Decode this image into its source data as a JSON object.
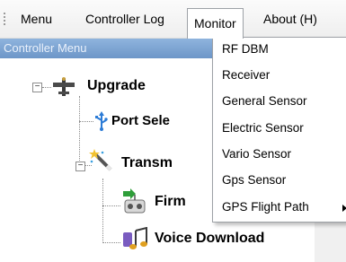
{
  "menubar": {
    "items": [
      {
        "label": "Menu"
      },
      {
        "label": "Controller Log"
      },
      {
        "label": "Monitor"
      },
      {
        "label": "About (H)"
      }
    ]
  },
  "panel": {
    "header": "Controller Menu",
    "tree": [
      {
        "label": "Upgrade",
        "icon": "airplane-icon"
      },
      {
        "label": "Port Sele",
        "icon": "usb-icon"
      },
      {
        "label": "Transm",
        "icon": "magic-wand-icon"
      },
      {
        "label": "Firm",
        "icon": "transmitter-icon"
      },
      {
        "label": "Voice Download",
        "icon": "music-note-icon"
      }
    ]
  },
  "monitor_menu": {
    "items": [
      {
        "label": "RF DBM"
      },
      {
        "label": "Receiver"
      },
      {
        "label": "General Sensor"
      },
      {
        "label": "Electric Sensor"
      },
      {
        "label": "Vario Sensor"
      },
      {
        "label": "Gps Sensor"
      },
      {
        "label": "GPS Flight Path",
        "has_submenu": true
      }
    ]
  },
  "colors": {
    "header_gradient_top": "#8fb4de",
    "header_gradient_bottom": "#6d96c8"
  }
}
